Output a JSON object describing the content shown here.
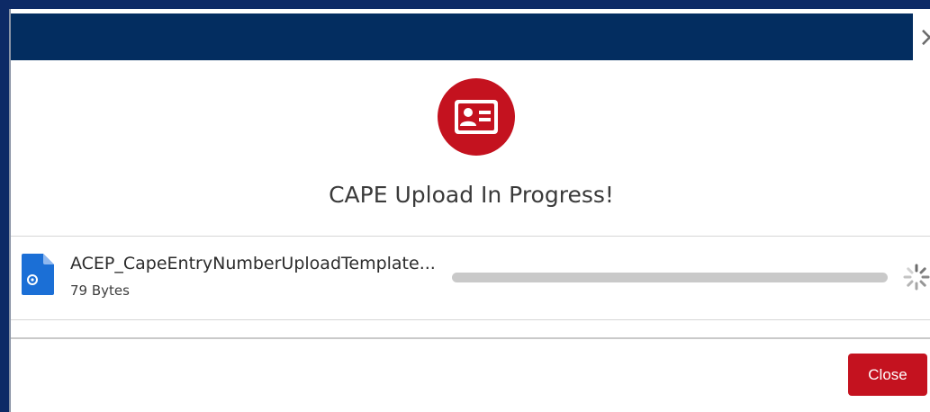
{
  "dialog": {
    "title": "CAPE Upload In Progress!",
    "header_close_glyph": "×",
    "header_color": "#032d60",
    "icon": "contact-card-icon",
    "icon_color": "#c4121f"
  },
  "file": {
    "name": "ACEP_CapeEntryNumberUploadTemplate...",
    "size": "79 Bytes",
    "icon": "document-icon",
    "status_icon": "loading-spinner-icon"
  },
  "footer": {
    "close_label": "Close",
    "button_color": "#c4121f"
  }
}
